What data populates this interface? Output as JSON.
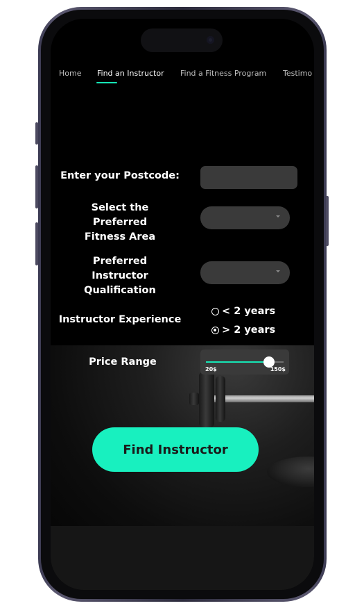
{
  "nav": {
    "items": [
      {
        "label": "Home"
      },
      {
        "label": "Find an Instructor"
      },
      {
        "label": "Find a Fitness Program"
      },
      {
        "label": "Testimo"
      }
    ],
    "active_index": 1
  },
  "form": {
    "postcode": {
      "label": "Enter your Postcode:",
      "value": ""
    },
    "fitness_area": {
      "label": "Select the Preferred Fitness Area",
      "selected": ""
    },
    "qualification": {
      "label": "Preferred Instructor Qualification",
      "selected": ""
    },
    "experience": {
      "label": "Instructor Experience",
      "options": [
        {
          "label": "< 2 years",
          "checked": false
        },
        {
          "label": "> 2 years",
          "checked": true
        }
      ]
    },
    "price": {
      "label": "Price Range",
      "min_label": "20$",
      "max_label": "150$",
      "min": 20,
      "max": 150,
      "value": 126
    }
  },
  "cta": {
    "label": "Find Instructor"
  },
  "colors": {
    "accent": "#16e6b6",
    "button": "#18f0bf",
    "field_bg": "#3a3a3a",
    "background": "#000000"
  }
}
